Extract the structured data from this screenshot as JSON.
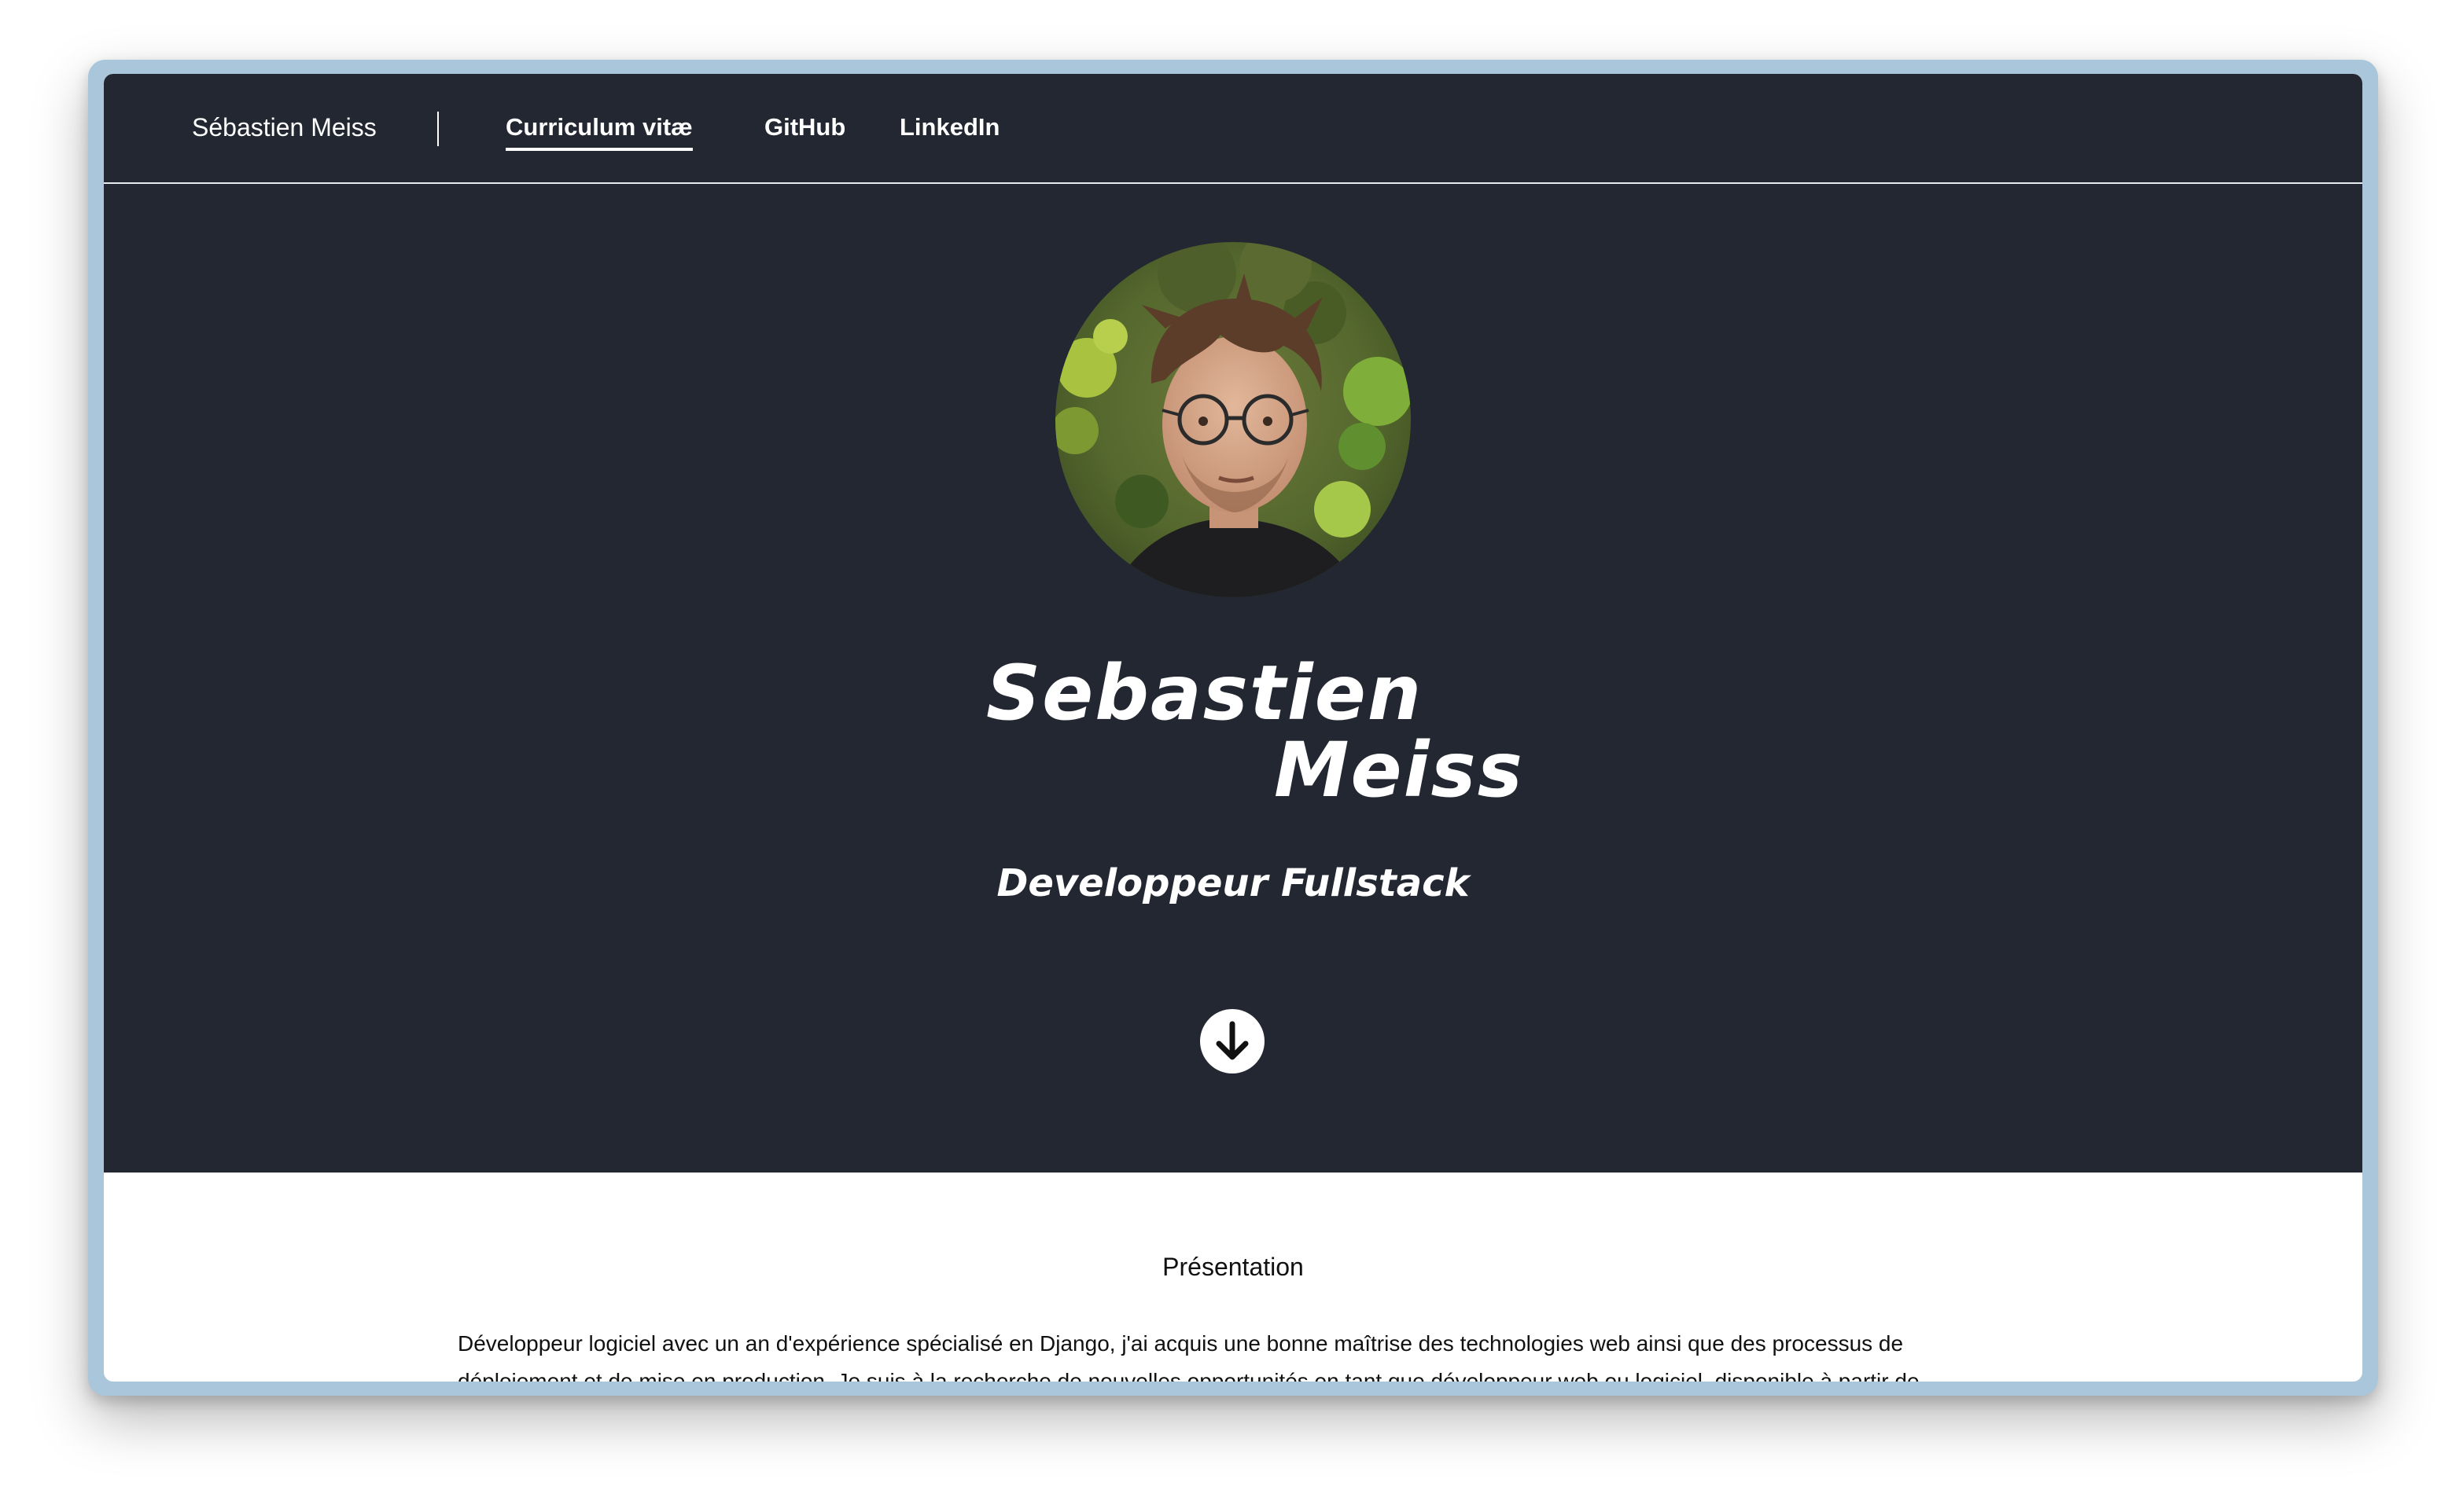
{
  "navbar": {
    "brand": "Sébastien Meiss",
    "links": [
      {
        "label": "Curriculum vitæ",
        "active": true
      },
      {
        "label": "GitHub",
        "active": false
      },
      {
        "label": "LinkedIn",
        "active": false
      }
    ]
  },
  "hero": {
    "first_name": "Sebastien",
    "last_name": "Meiss",
    "job_title": "Developpeur Fullstack",
    "scroll_icon": "arrow-down-circle-icon"
  },
  "presentation": {
    "title": "Présentation",
    "text": "Développeur logiciel avec un an d'expérience spécialisé en Django, j'ai acquis une bonne maîtrise des technologies web ainsi que des processus de déploiement et de mise en production. Je suis à la recherche de nouvelles opportunités en tant que développeur web ou logiciel, disponible à partir de"
  },
  "colors": {
    "hero_background": "#222731",
    "frame": "#a9c6da",
    "text_light": "#ffffff",
    "text_dark": "#111111"
  }
}
